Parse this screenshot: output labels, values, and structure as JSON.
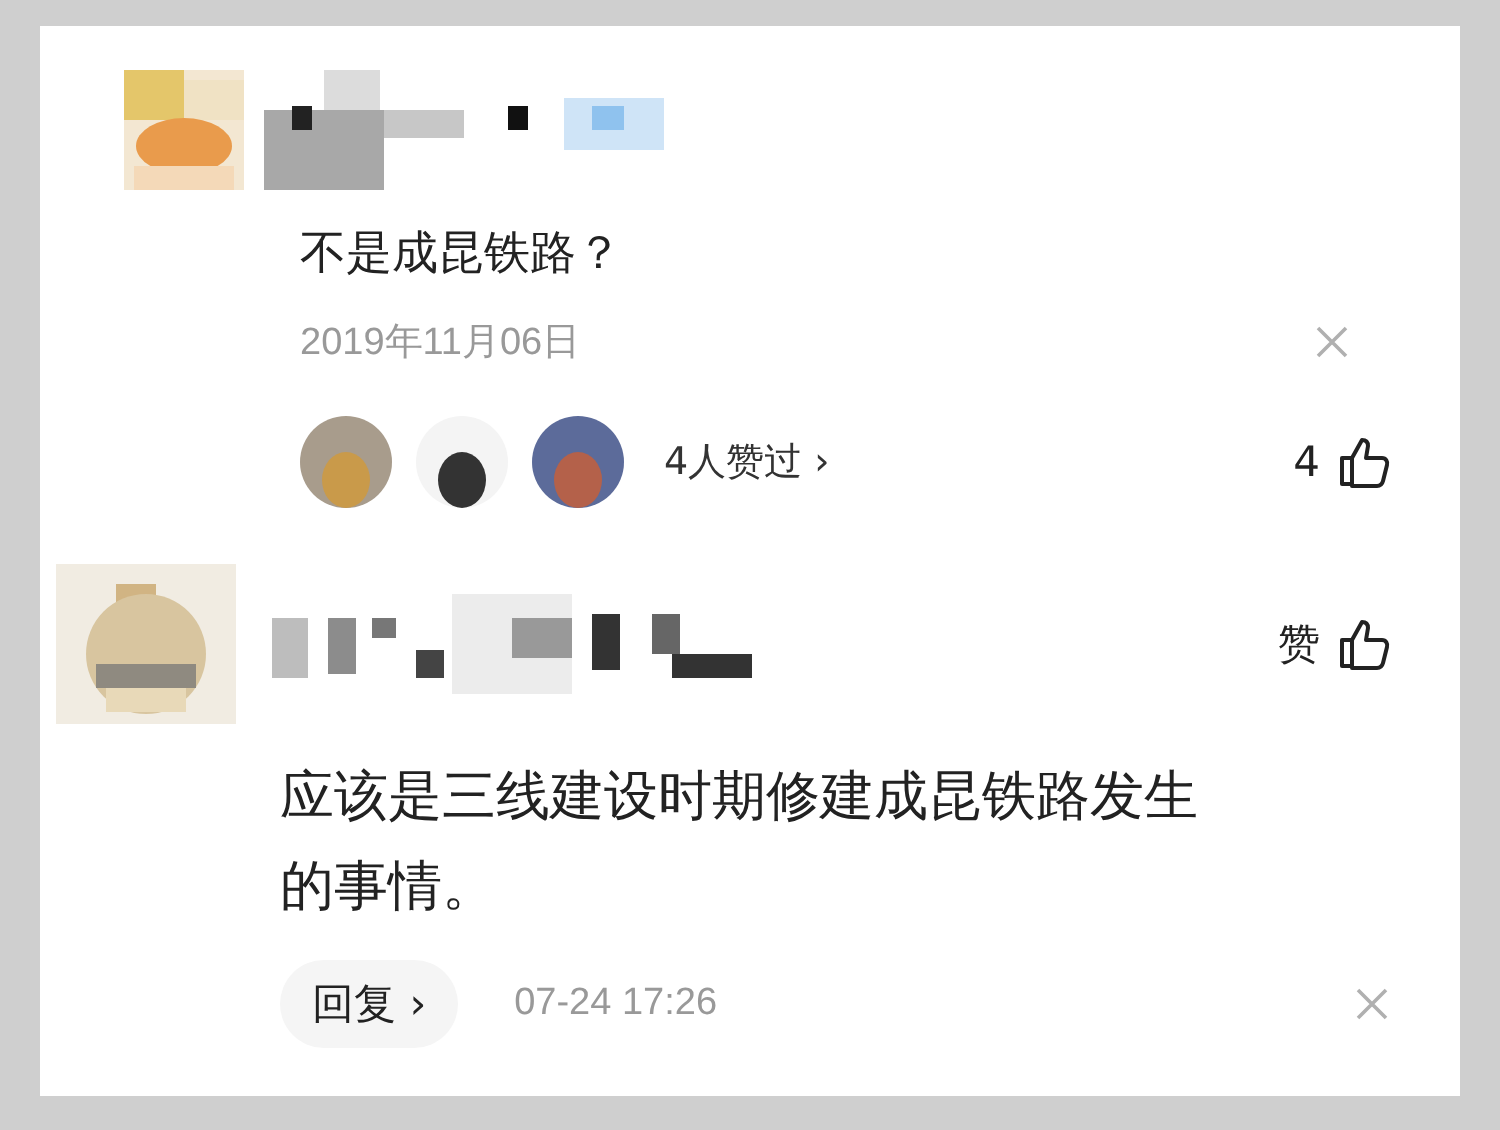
{
  "comments": [
    {
      "text": "不是成昆铁路？",
      "date": "2019年11月06日",
      "likes_label": "4人赞过",
      "likes_arrow": "›",
      "like_count": "4"
    },
    {
      "text": "应该是三线建设时期修建成昆铁路发生的事情。",
      "like_label": "赞",
      "reply_button": "回复",
      "reply_arrow": "›",
      "time": "07-24 17:26"
    }
  ]
}
